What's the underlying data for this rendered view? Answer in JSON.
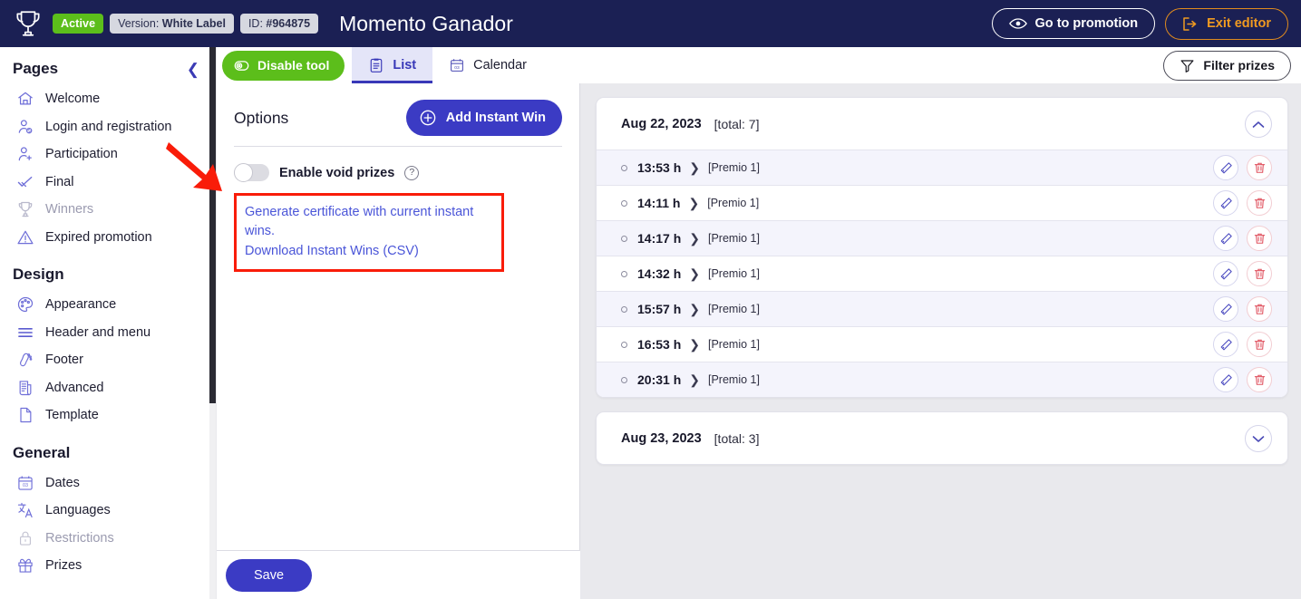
{
  "topbar": {
    "logo_icon": "trophy-icon",
    "status_badge": "Active",
    "version_label": "Version:",
    "version_value": "White Label",
    "id_label": "ID:",
    "id_value": "#964875",
    "title": "Momento Ganador",
    "go_to_promotion": "Go to promotion",
    "exit_editor": "Exit editor",
    "eye_icon": "eye-icon",
    "exit_icon": "exit-arrow-icon"
  },
  "sidebar": {
    "collapse_icon": "chevron-left-icon",
    "sections": [
      {
        "title": "Pages",
        "items": [
          {
            "label": "Welcome",
            "icon": "home-icon",
            "muted": false
          },
          {
            "label": "Login and registration",
            "icon": "user-gear-icon",
            "muted": false
          },
          {
            "label": "Participation",
            "icon": "user-plus-icon",
            "muted": false
          },
          {
            "label": "Final",
            "icon": "check-badge-icon",
            "muted": false
          },
          {
            "label": "Winners",
            "icon": "trophy-icon",
            "muted": true
          },
          {
            "label": "Expired promotion",
            "icon": "warning-triangle-icon",
            "muted": false
          }
        ]
      },
      {
        "title": "Design",
        "items": [
          {
            "label": "Appearance",
            "icon": "palette-icon",
            "muted": false
          },
          {
            "label": "Header and menu",
            "icon": "menu-lines-icon",
            "muted": false
          },
          {
            "label": "Footer",
            "icon": "footprint-icon",
            "muted": false
          },
          {
            "label": "Advanced",
            "icon": "document-code-icon",
            "muted": false
          },
          {
            "label": "Template",
            "icon": "page-icon",
            "muted": false
          }
        ]
      },
      {
        "title": "General",
        "items": [
          {
            "label": "Dates",
            "icon": "calendar-icon",
            "muted": false
          },
          {
            "label": "Languages",
            "icon": "translate-icon",
            "muted": false
          },
          {
            "label": "Restrictions",
            "icon": "lock-icon",
            "muted": true
          },
          {
            "label": "Prizes",
            "icon": "gift-icon",
            "muted": false
          }
        ]
      }
    ]
  },
  "tabbar": {
    "disable_tool": "Disable tool",
    "disable_icon": "power-toggle-icon",
    "tabs": [
      {
        "label": "List",
        "icon": "list-clipboard-icon",
        "active": true
      },
      {
        "label": "Calendar",
        "icon": "calendar-icon",
        "active": false
      }
    ],
    "filter_prizes": "Filter prizes",
    "filter_icon": "funnel-icon"
  },
  "options": {
    "title": "Options",
    "add_instant_win": "Add Instant Win",
    "add_icon": "plus-circle-icon",
    "toggle_label": "Enable void prizes",
    "toggle_on": false,
    "help_icon": "question-circle-icon",
    "help_glyph": "?",
    "links": [
      "Generate certificate with current instant wins.",
      "Download Instant Wins (CSV)"
    ],
    "highlight_color": "#f91c09",
    "save_label": "Save"
  },
  "instant_wins": {
    "prize_label": "[Premio 1]",
    "row_chevron_icon": "chevron-right-icon",
    "edit_icon": "pencil-icon",
    "delete_icon": "trash-icon",
    "groups": [
      {
        "date": "Aug 22, 2023",
        "total": "[total: 7]",
        "expanded": true,
        "toggle_icon": "chevron-up-icon",
        "rows": [
          {
            "time": "13:53 h",
            "prize": "[Premio 1]"
          },
          {
            "time": "14:11 h",
            "prize": "[Premio 1]"
          },
          {
            "time": "14:17 h",
            "prize": "[Premio 1]"
          },
          {
            "time": "14:32 h",
            "prize": "[Premio 1]"
          },
          {
            "time": "15:57 h",
            "prize": "[Premio 1]"
          },
          {
            "time": "16:53 h",
            "prize": "[Premio 1]"
          },
          {
            "time": "20:31 h",
            "prize": "[Premio 1]"
          }
        ]
      },
      {
        "date": "Aug 23, 2023",
        "total": "[total: 3]",
        "expanded": false,
        "toggle_icon": "chevron-down-icon",
        "rows": []
      }
    ]
  },
  "colors": {
    "header_bg": "#1b2054",
    "accent_blue": "#3b3bc4",
    "accent_green": "#5cbe1b",
    "accent_orange": "#f09a21",
    "annotation_red": "#f91c09",
    "link_blue": "#4a55d8"
  }
}
